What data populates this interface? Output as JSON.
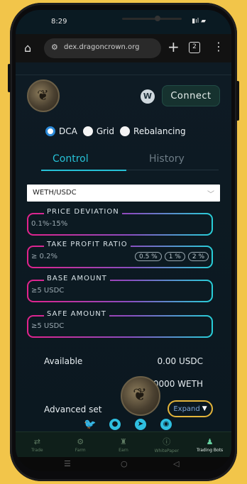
{
  "status_bar": {
    "time": "8:29",
    "icons": "▮ıl ▰"
  },
  "browser": {
    "url": "dex.dragoncrown.org",
    "tab_count": "2"
  },
  "header": {
    "connect_label": "Connect"
  },
  "modes": [
    {
      "label": "DCA",
      "selected": true
    },
    {
      "label": "Grid",
      "selected": false
    },
    {
      "label": "Rebalancing",
      "selected": false
    }
  ],
  "tabs": {
    "control": "Control",
    "history": "History"
  },
  "pair": {
    "value": "WETH/USDC"
  },
  "fields": {
    "price_deviation": {
      "label": "PRICE DEVIATION",
      "value": "0.1%-15%"
    },
    "take_profit": {
      "label": "TAKE PROFIT RATIO",
      "value": "≥ 0.2%",
      "chips": [
        "0.5 %",
        "1 %",
        "2 %"
      ]
    },
    "base_amount": {
      "label": "BASE AMOUNT",
      "value": "≥5 USDC"
    },
    "safe_amount": {
      "label": "SAFE AMOUNT",
      "value": "≥5 USDC"
    }
  },
  "balances": {
    "available_label": "Available",
    "usdc_value": "0.00 USDC",
    "weth_value": "000000 WETH"
  },
  "advanced": {
    "label": "Advanced set",
    "expand_label": "Expand"
  },
  "bottom_nav": [
    {
      "label": "Trade",
      "icon": "swap-icon"
    },
    {
      "label": "Farm",
      "icon": "tractor-icon"
    },
    {
      "label": "Earn",
      "icon": "coins-icon"
    },
    {
      "label": "WhitePaper",
      "icon": "info-icon"
    },
    {
      "label": "Trading Bots",
      "icon": "bot-icon",
      "active": true
    }
  ],
  "colors": {
    "accent_cyan": "#26c0d6",
    "accent_pink": "#e2228c",
    "expand_border": "#e4b53a"
  }
}
